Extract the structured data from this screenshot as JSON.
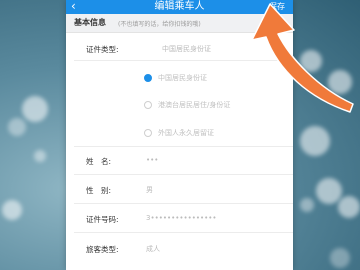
{
  "header": {
    "title": "编辑乘车人",
    "back_icon": "‹",
    "save_label": "保存"
  },
  "section": {
    "title": "基本信息",
    "hint": "(不也填写的话，给你扣钱的哦)"
  },
  "fields": {
    "id_type_label": "证件类型:",
    "id_type_options": [
      {
        "label": "中国居民身份证",
        "selected": true
      },
      {
        "label": "港澳台居民居住/身份证",
        "selected": false
      },
      {
        "label": "外国人永久居留证",
        "selected": false
      }
    ],
    "name_label": "姓　名:",
    "name_value": "•••",
    "gender_label": "性　别:",
    "gender_value": "男",
    "id_number_label": "证件号码:",
    "id_number_value": "3••••••••••••••••",
    "passenger_type_label": "旅客类型:",
    "passenger_type_value": "成人"
  },
  "colors": {
    "accent": "#1c8fe8",
    "arrow": "#f07a3a"
  }
}
